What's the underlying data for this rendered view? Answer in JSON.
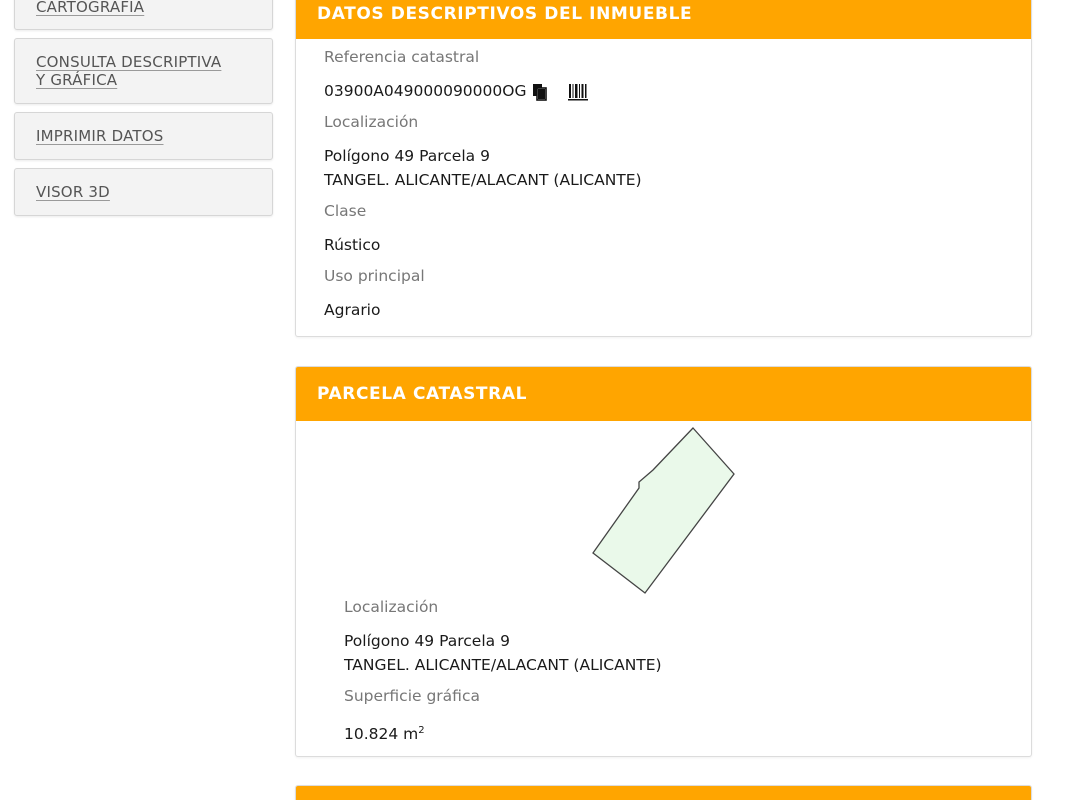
{
  "sidebar": {
    "items": [
      {
        "label": "CARTOGRAFÍA"
      },
      {
        "label_line1": "CONSULTA DESCRIPTIVA",
        "label_line2": "Y GRÁFICA"
      },
      {
        "label": "IMPRIMIR DATOS"
      },
      {
        "label": "VISOR 3D"
      }
    ]
  },
  "inmueble": {
    "title": "DATOS DESCRIPTIVOS DEL INMUEBLE",
    "ref_label": "Referencia catastral",
    "ref_value": "03900A049000090000OG",
    "copy_icon": "copy-icon",
    "barcode_icon": "barcode-icon",
    "loc_label": "Localización",
    "loc_line1": "Polígono 49 Parcela 9",
    "loc_line2": "TANGEL. ALICANTE/ALACANT (ALICANTE)",
    "clase_label": "Clase",
    "clase_value": "Rústico",
    "uso_label": "Uso principal",
    "uso_value": "Agrario"
  },
  "parcela": {
    "title": "PARCELA CATASTRAL",
    "map_fill": "#eaf9ea",
    "loc_label": "Localización",
    "loc_line1": "Polígono 49 Parcela 9",
    "loc_line2": "TANGEL. ALICANTE/ALACANT (ALICANTE)",
    "sup_label": "Superficie gráfica",
    "sup_value": "10.824 m",
    "sup_unit_exp": "2"
  },
  "colors": {
    "header_bg": "#ffa500",
    "header_text": "#ffffff"
  }
}
